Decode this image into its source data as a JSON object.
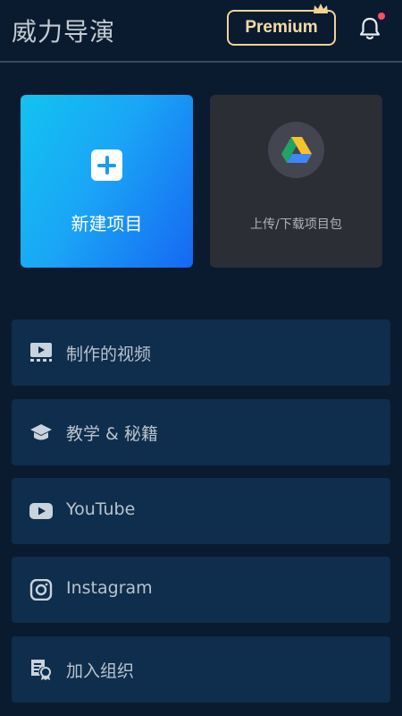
{
  "header": {
    "app_title": "威力导演",
    "premium_label": "Premium"
  },
  "cards": {
    "new_project_label": "新建项目",
    "upload_label": "上传/下载项目包"
  },
  "menu": [
    {
      "label": "制作的视频",
      "icon": "video-icon"
    },
    {
      "label": "教学 & 秘籍",
      "icon": "graduation-cap-icon"
    },
    {
      "label": "YouTube",
      "icon": "youtube-icon"
    },
    {
      "label": "Instagram",
      "icon": "instagram-icon"
    },
    {
      "label": "加入组织",
      "icon": "certificate-icon"
    }
  ],
  "colors": {
    "background": "#0a1b30",
    "menu_item": "#0f2d4c",
    "premium_gold": "#f2d394",
    "notification_dot": "#ff4d63"
  }
}
